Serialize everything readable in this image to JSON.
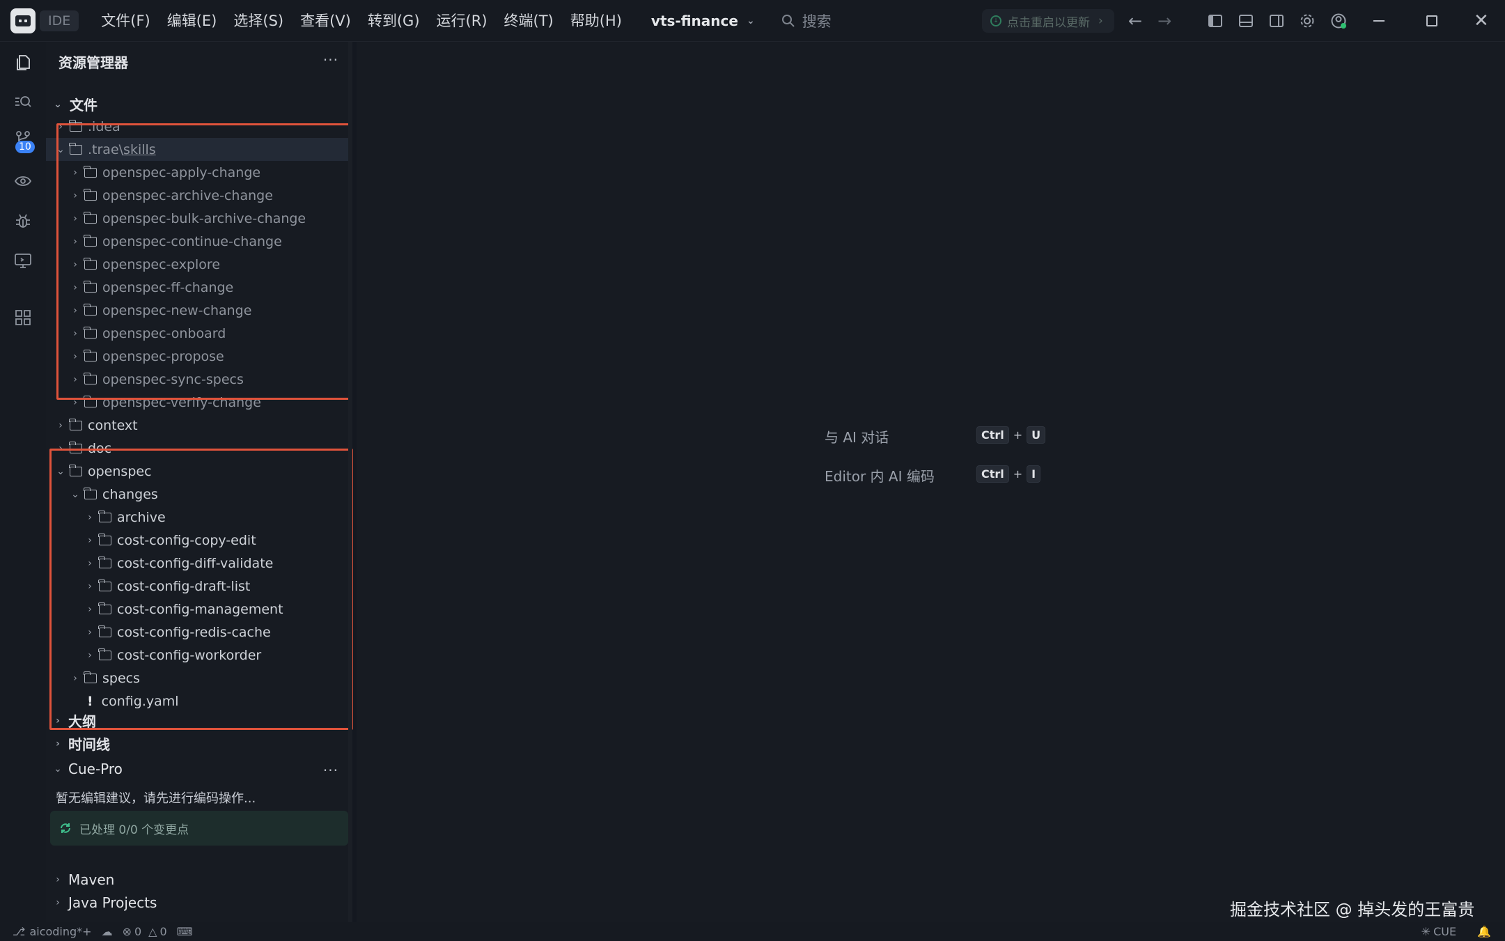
{
  "titlebar": {
    "ide_tag": "IDE",
    "menu": [
      "文件(F)",
      "编辑(E)",
      "选择(S)",
      "查看(V)",
      "转到(G)",
      "运行(R)",
      "终端(T)",
      "帮助(H)"
    ],
    "project": "vts-finance",
    "search_placeholder": "搜索",
    "update_label": "点击重启以更新"
  },
  "activity": {
    "scm_badge": "10"
  },
  "explorer": {
    "title": "资源管理器",
    "more": "···",
    "root": "文件",
    "rows": [
      {
        "label": ".idea",
        "depth": 1,
        "expanded": false,
        "dim": true
      },
      {
        "label": ".trae",
        "label2": "skills",
        "depth": 1,
        "expanded": true,
        "dim": true,
        "selected": true
      },
      {
        "label": "openspec-apply-change",
        "depth": 2,
        "expanded": false,
        "dim": true
      },
      {
        "label": "openspec-archive-change",
        "depth": 2,
        "expanded": false,
        "dim": true
      },
      {
        "label": "openspec-bulk-archive-change",
        "depth": 2,
        "expanded": false,
        "dim": true
      },
      {
        "label": "openspec-continue-change",
        "depth": 2,
        "expanded": false,
        "dim": true
      },
      {
        "label": "openspec-explore",
        "depth": 2,
        "expanded": false,
        "dim": true
      },
      {
        "label": "openspec-ff-change",
        "depth": 2,
        "expanded": false,
        "dim": true
      },
      {
        "label": "openspec-new-change",
        "depth": 2,
        "expanded": false,
        "dim": true
      },
      {
        "label": "openspec-onboard",
        "depth": 2,
        "expanded": false,
        "dim": true
      },
      {
        "label": "openspec-propose",
        "depth": 2,
        "expanded": false,
        "dim": true
      },
      {
        "label": "openspec-sync-specs",
        "depth": 2,
        "expanded": false,
        "dim": true
      },
      {
        "label": "openspec-verify-change",
        "depth": 2,
        "expanded": false,
        "dim": true
      },
      {
        "label": "context",
        "depth": 1,
        "expanded": false,
        "dim": false
      },
      {
        "label": "doc",
        "depth": 1,
        "expanded": false,
        "dim": false
      },
      {
        "label": "openspec",
        "depth": 1,
        "expanded": true,
        "dim": false
      },
      {
        "label": "changes",
        "depth": 2,
        "expanded": true,
        "dim": false
      },
      {
        "label": "archive",
        "depth": 3,
        "expanded": false,
        "dim": false
      },
      {
        "label": "cost-config-copy-edit",
        "depth": 3,
        "expanded": false,
        "dim": false
      },
      {
        "label": "cost-config-diff-validate",
        "depth": 3,
        "expanded": false,
        "dim": false
      },
      {
        "label": "cost-config-draft-list",
        "depth": 3,
        "expanded": false,
        "dim": false
      },
      {
        "label": "cost-config-management",
        "depth": 3,
        "expanded": false,
        "dim": false
      },
      {
        "label": "cost-config-redis-cache",
        "depth": 3,
        "expanded": false,
        "dim": false
      },
      {
        "label": "cost-config-workorder",
        "depth": 3,
        "expanded": false,
        "dim": false
      },
      {
        "label": "specs",
        "depth": 2,
        "expanded": false,
        "dim": false
      },
      {
        "label": "config.yaml",
        "depth": 2,
        "file": true,
        "dim": false
      }
    ]
  },
  "sections": {
    "outline": "大纲",
    "timeline": "时间线",
    "cue": "Cue-Pro",
    "cue_more": "···",
    "cue_message": "暂无编辑建议，请先进行编码操作...",
    "cue_status": "已处理 0/0 个变更点",
    "maven": "Maven",
    "java": "Java Projects"
  },
  "editor": {
    "hint1": "与 AI 对话",
    "hint1_keys": [
      "Ctrl",
      "U"
    ],
    "hint2": "Editor 内 AI 编码",
    "hint2_keys": [
      "Ctrl",
      "I"
    ],
    "plus": "+"
  },
  "watermark": "掘金技术社区 @ 掉头发的王富贵",
  "status": {
    "branch": "aicoding*+",
    "errors": "0",
    "warnings": "0",
    "cue": "CUE"
  }
}
